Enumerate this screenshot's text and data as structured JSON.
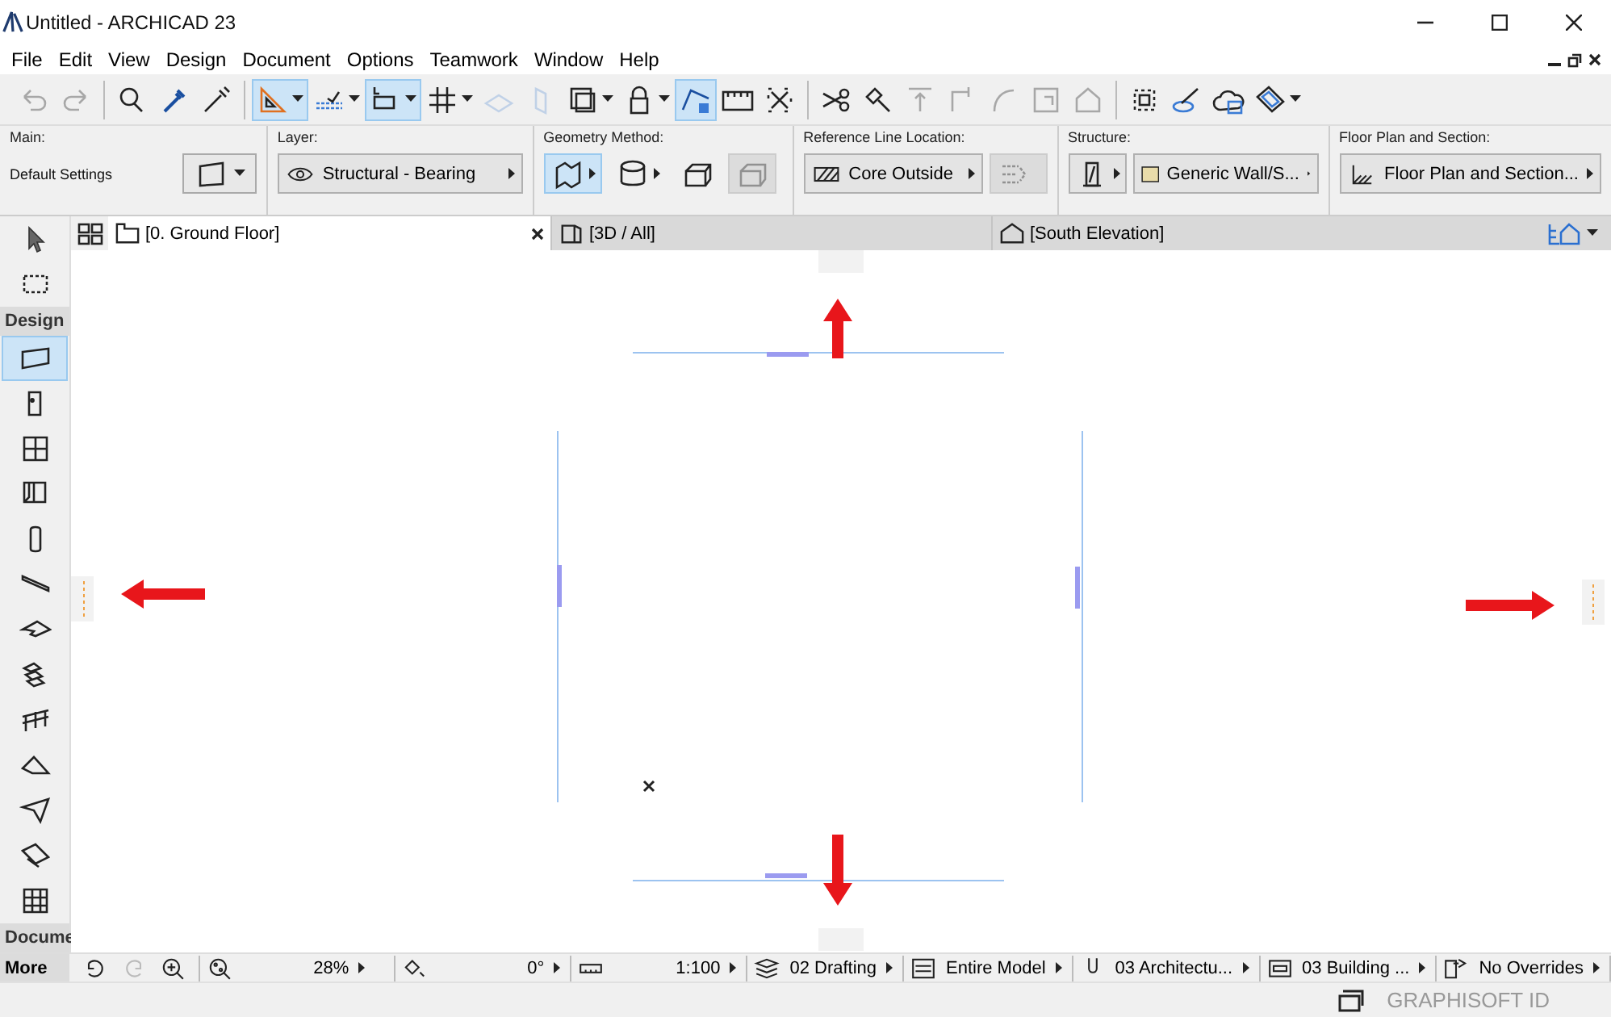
{
  "window": {
    "title": "Untitled - ARCHICAD 23"
  },
  "menu": [
    "File",
    "Edit",
    "View",
    "Design",
    "Document",
    "Options",
    "Teamwork",
    "Window",
    "Help"
  ],
  "toolbar": [
    [
      {
        "selected": false,
        "disabled": true,
        "menu": false
      },
      {
        "selected": false,
        "disabled": true,
        "menu": false
      }
    ],
    [
      {
        "selected": false,
        "disabled": false,
        "menu": false
      },
      {
        "selected": false,
        "disabled": false,
        "menu": false
      },
      {
        "selected": false,
        "disabled": false,
        "menu": false
      }
    ],
    [
      {
        "selected": true,
        "disabled": false,
        "menu": true
      },
      {
        "selected": false,
        "disabled": false,
        "menu": true
      },
      {
        "selected": true,
        "disabled": false,
        "menu": true
      },
      {
        "selected": false,
        "disabled": false,
        "menu": true
      },
      {
        "selected": false,
        "disabled": true,
        "menu": false
      },
      {
        "selected": false,
        "disabled": true,
        "menu": false
      },
      {
        "selected": false,
        "disabled": false,
        "menu": true
      },
      {
        "selected": false,
        "disabled": false,
        "menu": true
      },
      {
        "selected": true,
        "disabled": false,
        "menu": false
      },
      {
        "selected": false,
        "disabled": false,
        "menu": false
      },
      {
        "selected": false,
        "disabled": false,
        "menu": false
      }
    ],
    [
      {
        "selected": false,
        "disabled": false,
        "menu": false
      },
      {
        "selected": false,
        "disabled": false,
        "menu": false
      },
      {
        "selected": false,
        "disabled": true,
        "menu": false
      },
      {
        "selected": false,
        "disabled": true,
        "menu": false
      },
      {
        "selected": false,
        "disabled": true,
        "menu": false
      },
      {
        "selected": false,
        "disabled": true,
        "menu": false
      },
      {
        "selected": false,
        "disabled": true,
        "menu": false
      }
    ],
    [
      {
        "selected": false,
        "disabled": false,
        "menu": false
      },
      {
        "selected": false,
        "disabled": false,
        "menu": false
      },
      {
        "selected": false,
        "disabled": false,
        "menu": false
      },
      {
        "selected": false,
        "disabled": false,
        "menu": true
      }
    ]
  ],
  "info_box": [
    {
      "label": "Main:",
      "controls": [
        {
          "kind": "text",
          "text": "Default Settings"
        },
        {
          "kind": "picker"
        }
      ]
    },
    {
      "label": "Layer:",
      "controls": [
        {
          "kind": "dropdown",
          "text": "Structural - Bearing"
        }
      ]
    },
    {
      "label": "Geometry Method:",
      "controls": [
        {
          "kind": "icon",
          "selected": true,
          "disabled": false,
          "arrow": true
        },
        {
          "kind": "icon",
          "selected": false,
          "disabled": false,
          "arrow": true
        },
        {
          "kind": "icon",
          "selected": false,
          "disabled": false,
          "arrow": false
        },
        {
          "kind": "icon",
          "selected": false,
          "disabled": true,
          "arrow": false
        }
      ]
    },
    {
      "label": "Reference Line Location:",
      "controls": [
        {
          "kind": "dropdown",
          "text": "Core Outside"
        },
        {
          "kind": "icon",
          "selected": false,
          "disabled": true,
          "arrow": false
        }
      ]
    },
    {
      "label": "Structure:",
      "controls": [
        {
          "kind": "icon",
          "selected": false,
          "disabled": false,
          "arrow": true
        },
        {
          "kind": "dropdown",
          "text": "Generic Wall/S..."
        }
      ]
    },
    {
      "label": "Floor Plan and Section:",
      "controls": [
        {
          "kind": "dropdown",
          "text": "Floor Plan and Section..."
        }
      ]
    }
  ],
  "tabs": [
    {
      "label": "[0. Ground Floor]",
      "selected": true
    },
    {
      "label": "[3D / All]",
      "selected": false
    },
    {
      "label": "[South Elevation]",
      "selected": false
    }
  ],
  "toolbox": [
    {
      "kind": "tool",
      "selected": false
    },
    {
      "kind": "tool",
      "selected": false
    },
    {
      "kind": "header",
      "text": "Design"
    },
    {
      "kind": "tool",
      "selected": true
    },
    {
      "kind": "tool",
      "selected": false
    },
    {
      "kind": "tool",
      "selected": false
    },
    {
      "kind": "tool",
      "selected": false
    },
    {
      "kind": "tool",
      "selected": false
    },
    {
      "kind": "tool",
      "selected": false
    },
    {
      "kind": "tool",
      "selected": false
    },
    {
      "kind": "tool",
      "selected": false
    },
    {
      "kind": "tool",
      "selected": false
    },
    {
      "kind": "tool",
      "selected": false
    },
    {
      "kind": "tool",
      "selected": false
    },
    {
      "kind": "tool",
      "selected": false
    },
    {
      "kind": "tool",
      "selected": false
    },
    {
      "kind": "header",
      "text": "Docume"
    }
  ],
  "status_bar": {
    "more": "More",
    "items": [
      "28%",
      "0°",
      "1:100",
      "02 Drafting",
      "Entire Model",
      "03 Architectu...",
      "03 Building ...",
      "No Overrides"
    ]
  },
  "footer": {
    "id_label": "GRAPHISOFT ID"
  }
}
